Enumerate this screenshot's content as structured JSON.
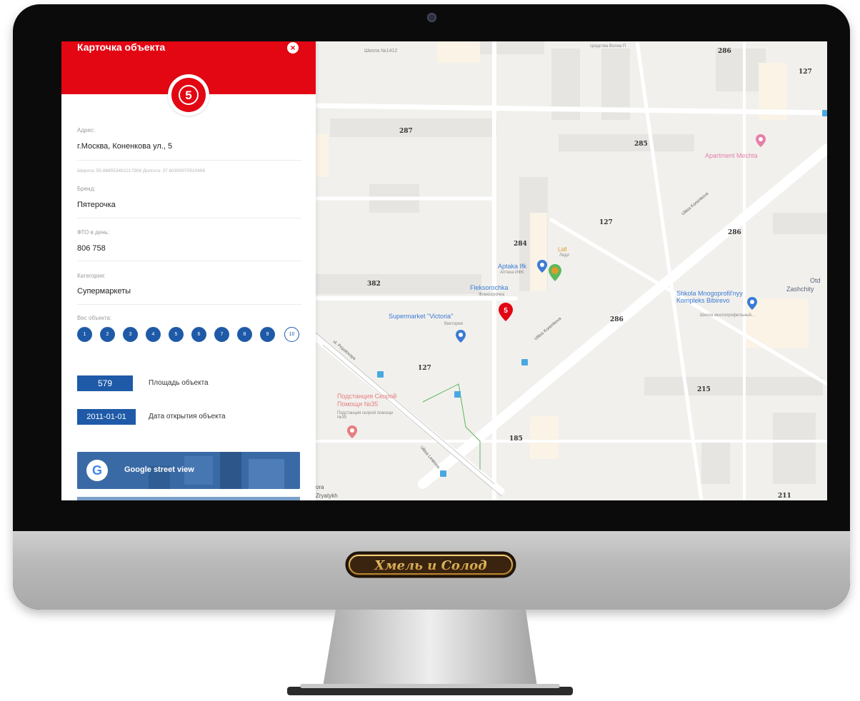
{
  "panel": {
    "title": "Карточка объекта",
    "close_icon": "close-icon",
    "address": {
      "label": "Адрес:",
      "value": "г.Москва, Коненкова ул., 5"
    },
    "coords": "Широта: 55.888553452217908   Долгота: 37.60300070520469",
    "brand": {
      "label": "Бренд:",
      "value": "Пятерочка"
    },
    "fto": {
      "label": "ФТО в день:",
      "value": "806 758"
    },
    "category": {
      "label": "Категория:",
      "value": "Супермаркеты"
    },
    "weight": {
      "label": "Вес объекта:",
      "levels": [
        "1",
        "2",
        "3",
        "4",
        "5",
        "6",
        "7",
        "8",
        "9",
        "10"
      ],
      "selected": "10"
    },
    "area": {
      "value": "579",
      "label": "Площадь объекта"
    },
    "opening": {
      "value": "2011-01-01",
      "label": "Дата открытия объекта"
    },
    "street_view": {
      "label": "Google street view",
      "icon": "G"
    }
  },
  "map": {
    "building_numbers": [
      "286",
      "127",
      "287",
      "285",
      "127",
      "284",
      "286",
      "382",
      "286",
      "127",
      "215",
      "185",
      "211"
    ],
    "pois": {
      "school_top": "Школа №1412",
      "services_top": "средства Волна П",
      "apartment": "Apartment Mechta",
      "lidl": "Lidl",
      "lidl_sub": "Лидл",
      "apteka": "Aptaka Ifk",
      "apteka_sub": "Аптека ИФК",
      "fleksorochka": "Fleksorochka",
      "fleksorochka_sub": "Флексорочка",
      "supermarket": "Supermarket \"Victoria\"",
      "supermarket_sub": "Виктория",
      "shkola": "Shkola Mnogoprofil'nyy Kompleks Bibirevo",
      "shkola_sub": "Школа многопрофильный...",
      "podstancia": "Подстанция Скорой Помощи №35",
      "podstancia_sub": "Подстанция скорой помощи №35",
      "otd": "Otd",
      "zashch": "Zashchity",
      "bottom_left": "ora",
      "bottom_left2": "Zryatykh",
      "street_kon": "Ulitsa Konenkova",
      "street_kon2": "Ulitsa Konenkova",
      "street_lesk": "Ulitsa Leskova",
      "street_pri": "ul. Pripolovaya"
    }
  },
  "monitor": {
    "logo_text": "Хмель и Солод"
  },
  "colors": {
    "brand_red": "#e30613",
    "accent_blue": "#1e5aa8"
  }
}
